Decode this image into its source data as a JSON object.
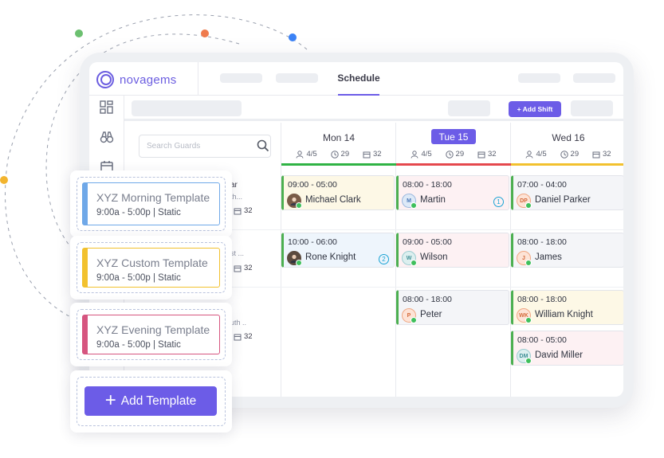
{
  "app": {
    "brand": "novagems",
    "active_tab": "Schedule",
    "accent": "#6c5ce7"
  },
  "toolbar": {
    "add_shift_label": "+ Add Shift"
  },
  "search": {
    "placeholder": "Search Guards"
  },
  "days": [
    {
      "label": "Mon 14",
      "guards": "4/5",
      "hours": "29",
      "count": "32",
      "bar_color": "#2fb344",
      "active": false
    },
    {
      "label": "Tue 15",
      "guards": "4/5",
      "hours": "29",
      "count": "32",
      "bar_color": "#e5484d",
      "active": true
    },
    {
      "label": "Wed 16",
      "guards": "4/5",
      "hours": "29",
      "count": "32",
      "bar_color": "#f2c12e",
      "active": false
    }
  ],
  "guard_rows": [
    {
      "name_fragment": "ar",
      "sub_fragment": "th...",
      "count": "32"
    },
    {
      "name_fragment": "st ...",
      "count": "32"
    },
    {
      "name_fragment": "uth ..",
      "count": "32"
    }
  ],
  "shifts": [
    {
      "time": "09:00 - 05:00",
      "name": "Michael Clark",
      "avatar": "",
      "avatar_icon": "person-photo-icon",
      "badge": ""
    },
    {
      "time": "08:00 - 18:00",
      "name": "Martin",
      "avatar": "M",
      "badge": "1"
    },
    {
      "time": "07:00 - 04:00",
      "name": "Daniel Parker",
      "avatar": "DP",
      "badge": ""
    },
    {
      "time": "10:00 - 06:00",
      "name": "Rone Knight",
      "avatar": "",
      "avatar_icon": "person-photo-icon",
      "badge": "2"
    },
    {
      "time": "09:00 - 05:00",
      "name": "Wilson",
      "avatar": "W",
      "badge": ""
    },
    {
      "time": "08:00 - 18:00",
      "name": "James",
      "avatar": "J",
      "badge": ""
    },
    {
      "time": "08:00 - 18:00",
      "name": "Peter",
      "avatar": "P",
      "badge": ""
    },
    {
      "time": "08:00 - 18:00",
      "name": "William Knight",
      "avatar": "WK",
      "badge": ""
    },
    {
      "time": "08:00 - 05:00",
      "name": "David Miller",
      "avatar": "DM",
      "badge": ""
    }
  ],
  "templates": [
    {
      "title": "XYZ Morning Template",
      "subtitle": "9:00a - 5:00p | Static",
      "color": "#6fa8e8"
    },
    {
      "title": "XYZ Custom Template",
      "subtitle": "9:00a - 5:00p | Static",
      "color": "#f2c12e"
    },
    {
      "title": "XYZ Evening Template",
      "subtitle": "9:00a - 5:00p | Static",
      "color": "#d6557f"
    }
  ],
  "add_template": {
    "label": "Add Template"
  }
}
